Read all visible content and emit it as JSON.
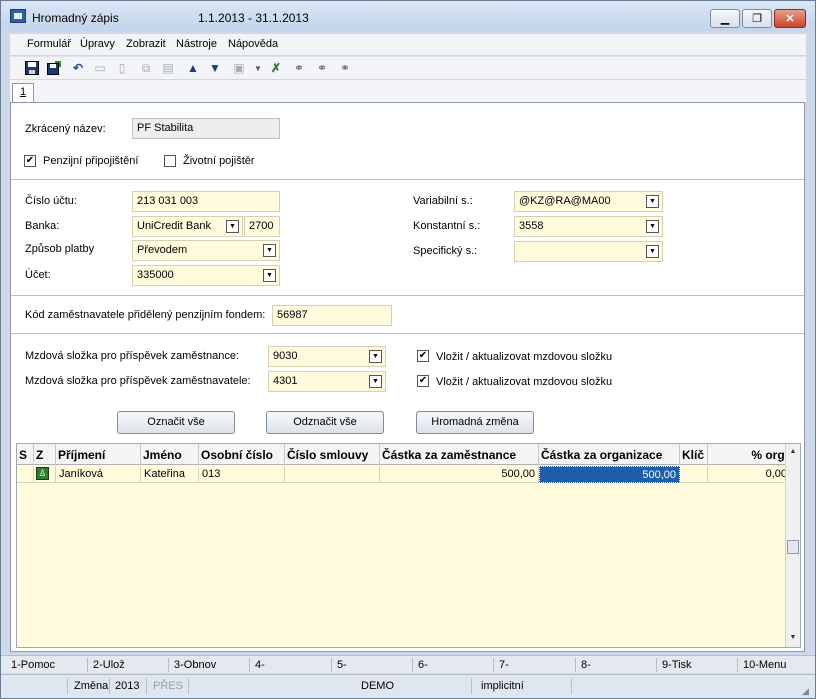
{
  "window": {
    "title": "Hromadný zápis",
    "period": "1.1.2013 - 31.1.2013",
    "buttons": {
      "minimize": "▁",
      "restore": "❐",
      "close": "✕"
    }
  },
  "menu": [
    "Formulář",
    "Úpravy",
    "Zobrazit",
    "Nástroje",
    "Nápověda"
  ],
  "toolbar": {
    "icons": [
      "save-icon",
      "save-close-icon",
      "undo-icon",
      "open-folder-icon",
      "new-document-icon",
      "copy-icon",
      "book-icon",
      "arrow-up-icon",
      "arrow-down-icon",
      "stamp-icon",
      "dropdown-arrow-icon",
      "find-icon",
      "binoculars-icon",
      "binoculars-next-icon",
      "binoculars-all-icon"
    ]
  },
  "tab": {
    "label": "1"
  },
  "form": {
    "short_name_label": "Zkrácený název:",
    "short_name_value": "PF Stabilita",
    "pension_label": "Penzijní připojištění",
    "pension_checked": true,
    "life_label": "Životní pojištěr",
    "life_checked": false,
    "account_label": "Číslo účtu:",
    "account_value": "213 031 003",
    "bank_label": "Banka:",
    "bank_value": "UniCredit Bank",
    "bank_code": "2700",
    "payment_label": "Způsob platby",
    "payment_value": "Převodem",
    "ucet_label": "Účet:",
    "ucet_value": "335000",
    "variable_label": "Variabilní s.:",
    "variable_value": "@KZ@RA@MA00",
    "constant_label": "Konstantní s.:",
    "constant_value": "3558",
    "specific_label": "Specifický s.:",
    "specific_value": "",
    "employer_code_label": "Kód zaměstnavatele přidělený penzijním fondem:",
    "employer_code_value": "56987",
    "employee_comp_label": "Mzdová složka pro příspěvek zaměstnance:",
    "employee_comp_value": "9030",
    "employer_comp_label": "Mzdová složka pro příspěvek zaměstnavatele:",
    "employer_comp_value": "4301",
    "insert_update_label_1": "Vložit / aktualizovat mzdovou složku",
    "insert_update_label_2": "Vložit / aktualizovat mzdovou složku",
    "insert_update_checked_1": true,
    "insert_update_checked_2": true
  },
  "buttons": {
    "select_all": "Označit vše",
    "deselect_all": "Odznačit vše",
    "bulk_change": "Hromadná změna"
  },
  "grid": {
    "columns": [
      "S",
      "Z",
      "Příjmení",
      "Jméno",
      "Osobní číslo",
      "Číslo smlouvy",
      "Částka za zaměstnance",
      "Částka za organizace",
      "Klíč",
      "% org."
    ],
    "rows": [
      {
        "s": "",
        "z": "check",
        "surname": "Janíková",
        "name": "Kateřina",
        "personal_no": "013",
        "contract_no": "",
        "employee_amount": "500,00",
        "organization_amount": "500,00",
        "key": "",
        "org_pct": "0,00"
      }
    ]
  },
  "fkeys": [
    "1-Pomoc",
    "2-Ulož",
    "3-Obnov",
    "4-",
    "5-",
    "6-",
    "7-",
    "8-",
    "9-Tisk",
    "10-Menu"
  ],
  "status": {
    "mode": "Změna",
    "year": "2013",
    "pres": "PŘES",
    "db": "DEMO",
    "profile": "implicitní"
  }
}
